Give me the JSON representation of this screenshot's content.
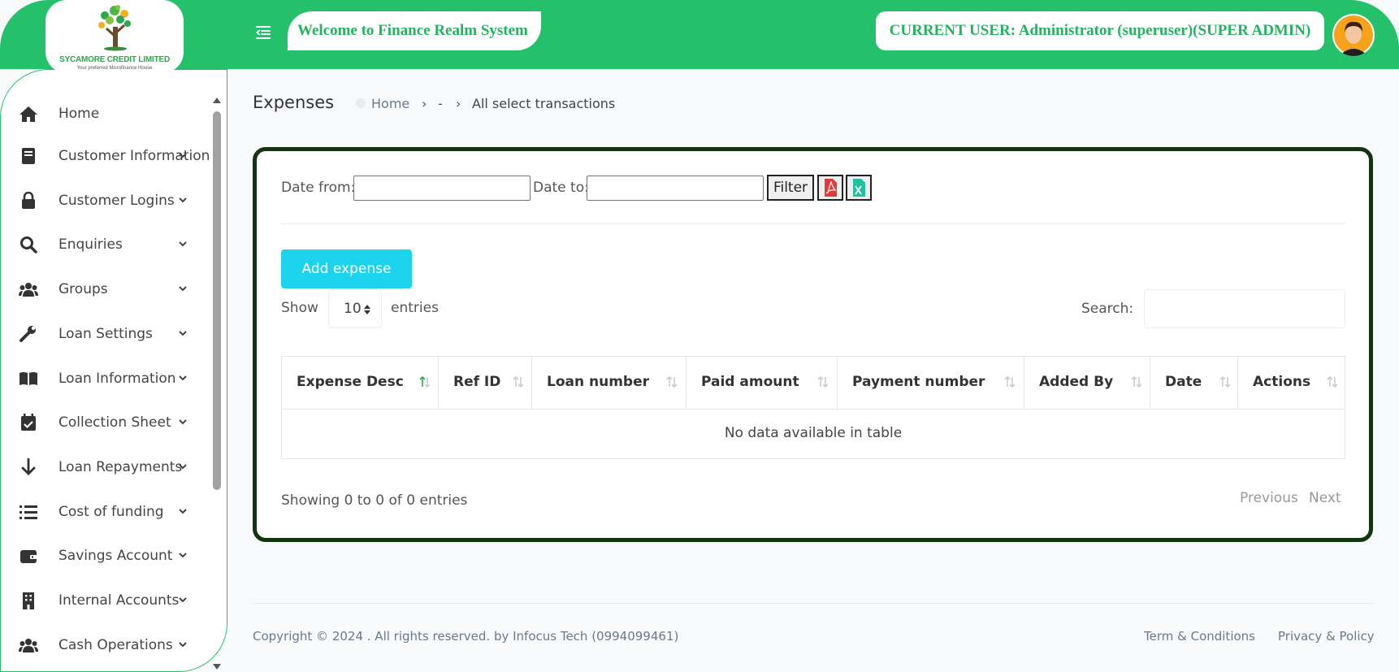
{
  "header": {
    "company_name": "SYCAMORE CREDIT LIMITED",
    "company_tagline": "Your preferred Microfinance House",
    "welcome": "Welcome to Finance Realm System",
    "current_user": "CURRENT USER: Administrator (superuser)(SUPER ADMIN)"
  },
  "sidebar": {
    "items": [
      {
        "label": "Home",
        "icon": "home-icon"
      },
      {
        "label": "Customer Information",
        "icon": "book-icon"
      },
      {
        "label": "Customer Logins",
        "icon": "lock-icon"
      },
      {
        "label": "Enquiries",
        "icon": "search-icon"
      },
      {
        "label": "Groups",
        "icon": "users-icon"
      },
      {
        "label": "Loan Settings",
        "icon": "wrench-icon"
      },
      {
        "label": "Loan Information",
        "icon": "open-book-icon"
      },
      {
        "label": "Collection Sheet",
        "icon": "calendar-check-icon"
      },
      {
        "label": "Loan Repayments",
        "icon": "arrow-down-icon"
      },
      {
        "label": "Cost of funding",
        "icon": "list-icon"
      },
      {
        "label": "Savings Account",
        "icon": "wallet-icon"
      },
      {
        "label": "Internal Accounts",
        "icon": "building-icon"
      },
      {
        "label": "Cash Operations",
        "icon": "users-icon"
      }
    ]
  },
  "page": {
    "title": "Expenses",
    "breadcrumb": [
      "Home",
      "-",
      "All select transactions"
    ]
  },
  "filters": {
    "date_from_label": "Date from:",
    "date_to_label": "Date to:",
    "filter_label": "Filter"
  },
  "actions": {
    "add_expense": "Add expense"
  },
  "table_controls": {
    "show_label": "Show",
    "page_length": "10",
    "entries_label": "entries",
    "search_label": "Search:"
  },
  "table": {
    "columns": [
      "Expense Desc",
      "Ref ID",
      "Loan number",
      "Paid amount",
      "Payment number",
      "Added By",
      "Date",
      "Actions"
    ],
    "empty_message": "No data available in table"
  },
  "pagination": {
    "info": "Showing 0 to 0 of 0 entries",
    "previous": "Previous",
    "next": "Next"
  },
  "footer": {
    "copyright": "Copyright © 2024 . All rights reserved. by Infocus Tech (0994099461)",
    "terms": "Term & Conditions",
    "privacy": "Privacy & Policy"
  },
  "colors": {
    "brand_green": "#25c16a",
    "card_border": "#10350f",
    "add_button": "#1cd3ee"
  }
}
